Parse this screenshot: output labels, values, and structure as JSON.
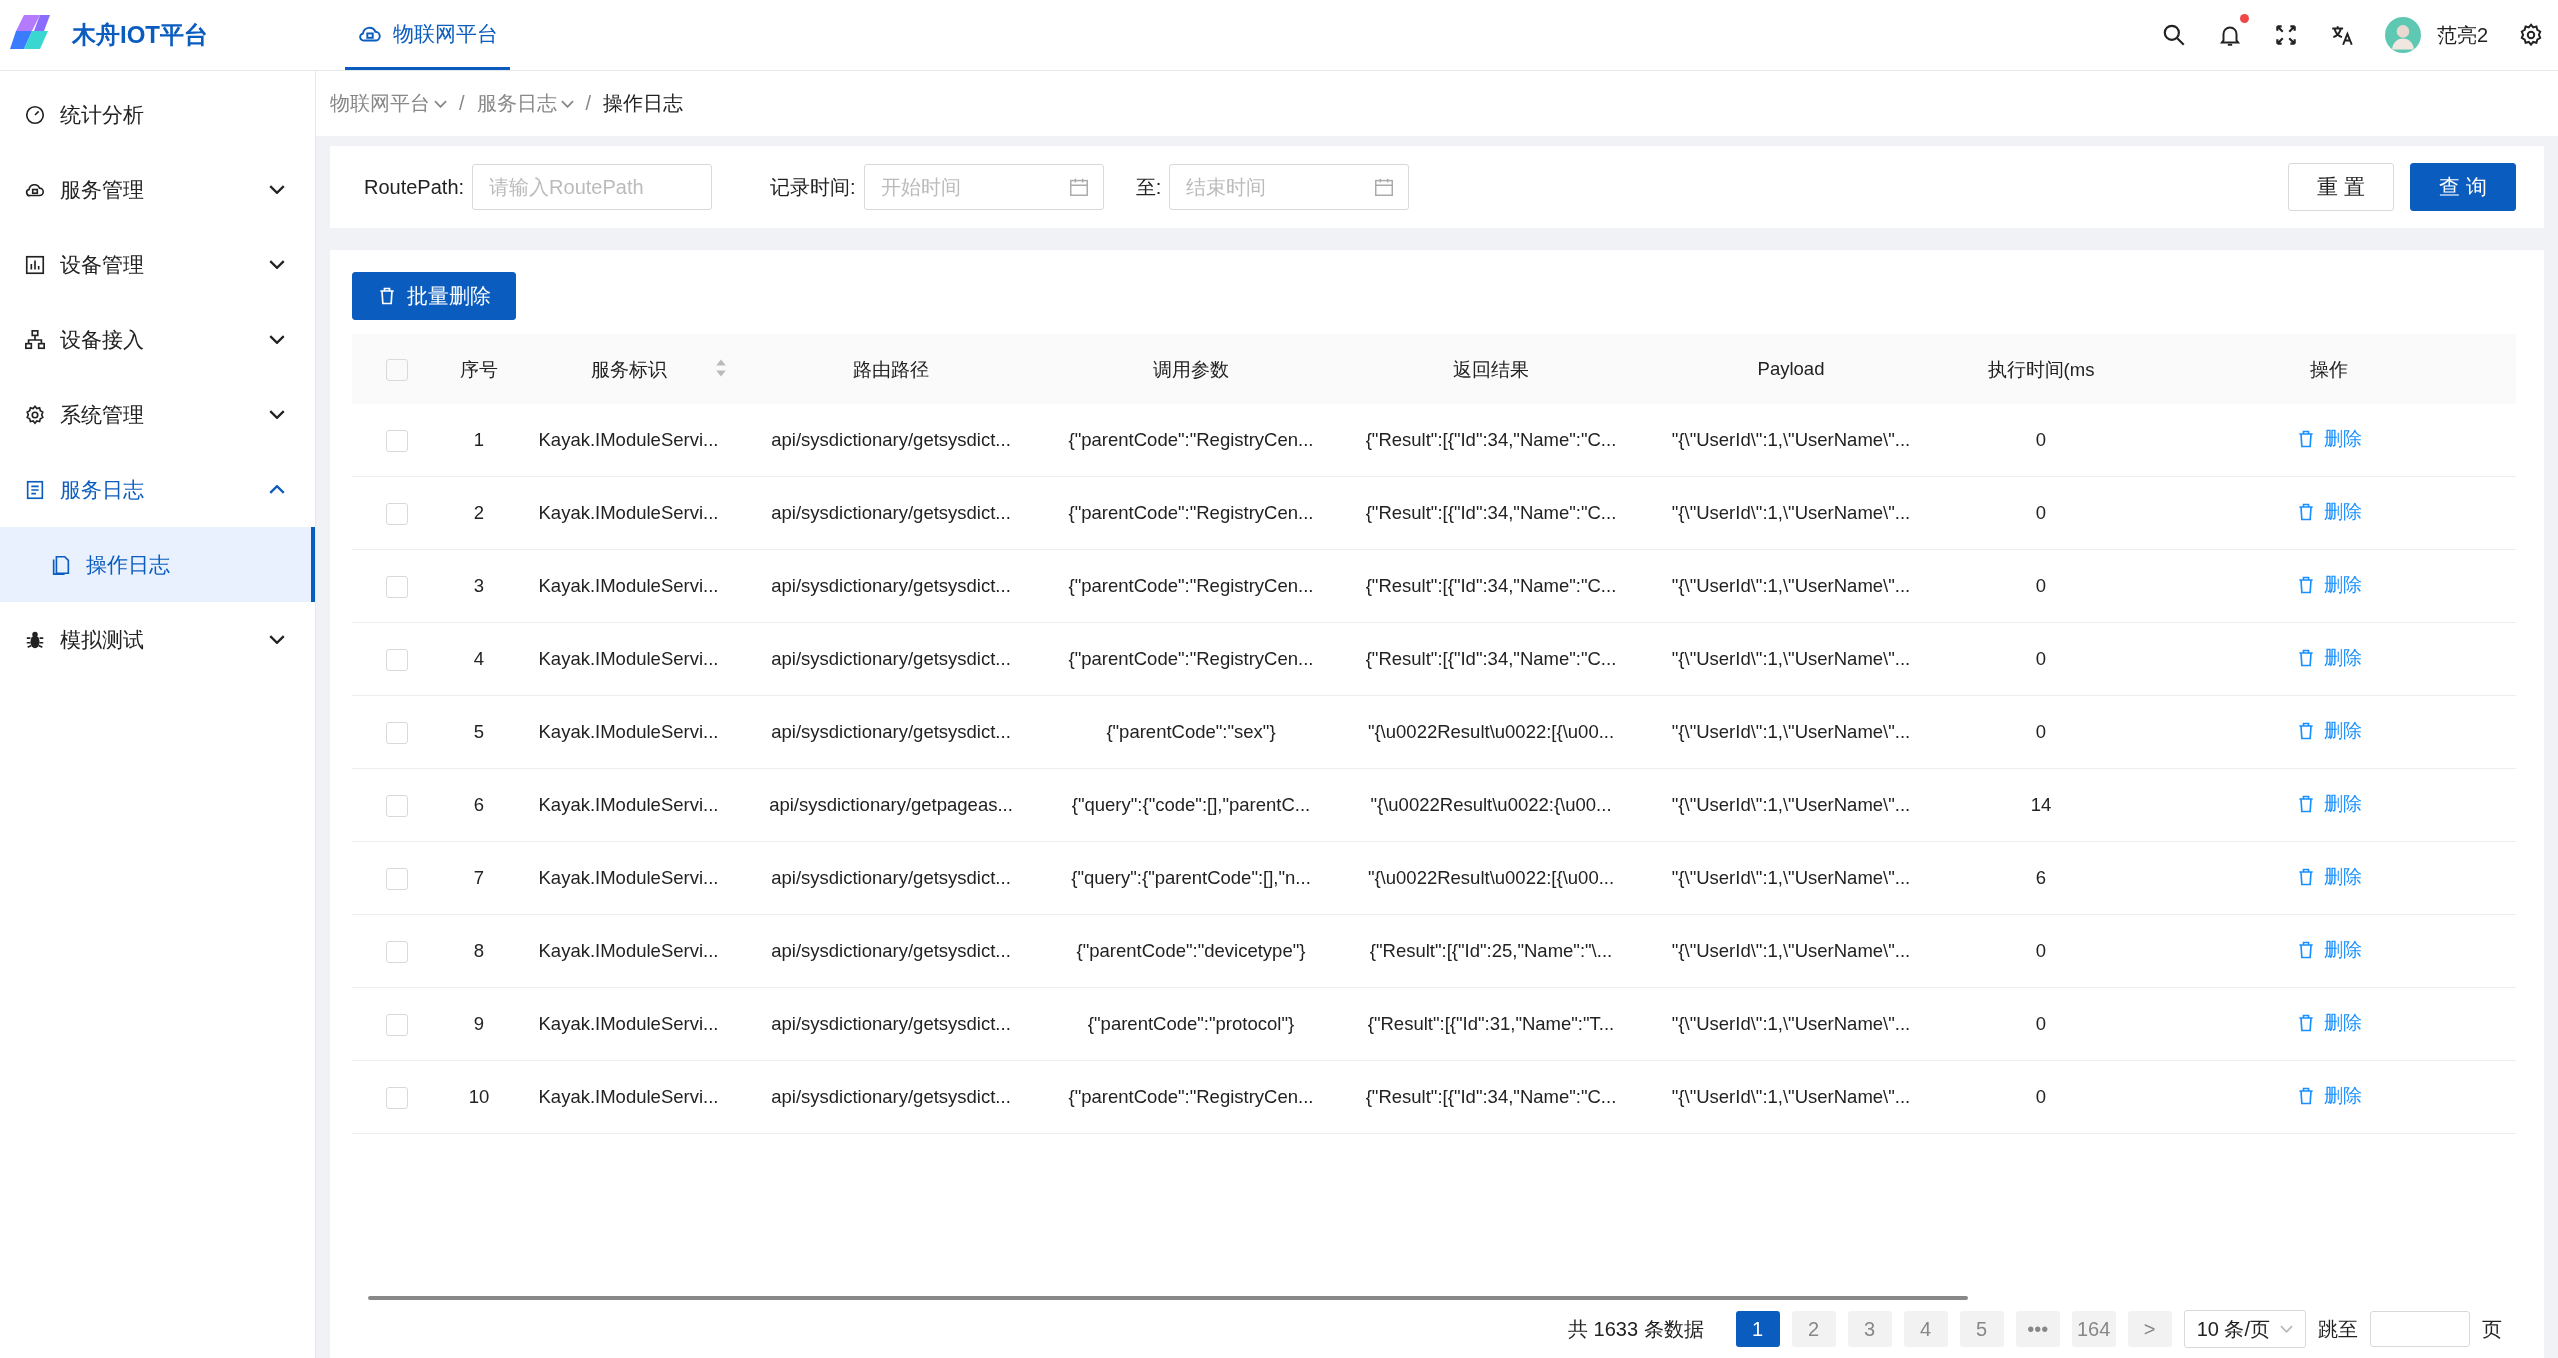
{
  "brand": {
    "title": "木舟IOT平台"
  },
  "top_tabs": [
    {
      "label": "物联网平台",
      "selected": true
    }
  ],
  "header": {
    "notification_dot": true,
    "user_name": "范亮2"
  },
  "sidebar": {
    "items": [
      {
        "label": "统计分析",
        "has_children": false,
        "expanded": false,
        "selected": false
      },
      {
        "label": "服务管理",
        "has_children": true,
        "expanded": false,
        "selected": false
      },
      {
        "label": "设备管理",
        "has_children": true,
        "expanded": false,
        "selected": false
      },
      {
        "label": "设备接入",
        "has_children": true,
        "expanded": false,
        "selected": false
      },
      {
        "label": "系统管理",
        "has_children": true,
        "expanded": false,
        "selected": false
      },
      {
        "label": "服务日志",
        "has_children": true,
        "expanded": true,
        "selected": true,
        "children": [
          {
            "label": "操作日志",
            "selected": true
          }
        ]
      },
      {
        "label": "模拟测试",
        "has_children": true,
        "expanded": false,
        "selected": false
      }
    ]
  },
  "breadcrumb": [
    {
      "label": "物联网平台",
      "dropdown": true
    },
    {
      "separator": "/",
      "label": "服务日志",
      "dropdown": true
    },
    {
      "separator": "/",
      "label": "操作日志",
      "dropdown": false
    }
  ],
  "filters": {
    "route_label": "RoutePath:",
    "route_placeholder": "请输入RoutePath",
    "time_label": "记录时间:",
    "start_placeholder": "开始时间",
    "to_label": "至:",
    "end_placeholder": "结束时间",
    "reset": "重 置",
    "query": "查 询"
  },
  "batch_delete": "批量删除",
  "table": {
    "select_all_checked": false,
    "columns": [
      "序号",
      "服务标识",
      "路由路径",
      "调用参数",
      "返回结果",
      "Payload",
      "执行时间(ms",
      "操作"
    ],
    "rows": [
      {
        "checked": false,
        "cells": [
          "1",
          "Kayak.IModuleServi...",
          "api/sysdictionary/getsysdict...",
          "{\"parentCode\":\"RegistryCen...",
          "{\"Result\":[{\"Id\":34,\"Name\":\"C...",
          "\"{\\\"UserId\\\":1,\\\"UserName\\\"...",
          "0"
        ],
        "action": "删除"
      },
      {
        "checked": false,
        "cells": [
          "2",
          "Kayak.IModuleServi...",
          "api/sysdictionary/getsysdict...",
          "{\"parentCode\":\"RegistryCen...",
          "{\"Result\":[{\"Id\":34,\"Name\":\"C...",
          "\"{\\\"UserId\\\":1,\\\"UserName\\\"...",
          "0"
        ],
        "action": "删除"
      },
      {
        "checked": false,
        "cells": [
          "3",
          "Kayak.IModuleServi...",
          "api/sysdictionary/getsysdict...",
          "{\"parentCode\":\"RegistryCen...",
          "{\"Result\":[{\"Id\":34,\"Name\":\"C...",
          "\"{\\\"UserId\\\":1,\\\"UserName\\\"...",
          "0"
        ],
        "action": "删除"
      },
      {
        "checked": false,
        "cells": [
          "4",
          "Kayak.IModuleServi...",
          "api/sysdictionary/getsysdict...",
          "{\"parentCode\":\"RegistryCen...",
          "{\"Result\":[{\"Id\":34,\"Name\":\"C...",
          "\"{\\\"UserId\\\":1,\\\"UserName\\\"...",
          "0"
        ],
        "action": "删除"
      },
      {
        "checked": false,
        "cells": [
          "5",
          "Kayak.IModuleServi...",
          "api/sysdictionary/getsysdict...",
          "{\"parentCode\":\"sex\"}",
          "\"{\\u0022Result\\u0022:[{\\u00...",
          "\"{\\\"UserId\\\":1,\\\"UserName\\\"...",
          "0"
        ],
        "action": "删除"
      },
      {
        "checked": false,
        "cells": [
          "6",
          "Kayak.IModuleServi...",
          "api/sysdictionary/getpageas...",
          "{\"query\":{\"code\":[],\"parentC...",
          "\"{\\u0022Result\\u0022:{\\u00...",
          "\"{\\\"UserId\\\":1,\\\"UserName\\\"...",
          "14"
        ],
        "action": "删除"
      },
      {
        "checked": false,
        "cells": [
          "7",
          "Kayak.IModuleServi...",
          "api/sysdictionary/getsysdict...",
          "{\"query\":{\"parentCode\":[],\"n...",
          "\"{\\u0022Result\\u0022:[{\\u00...",
          "\"{\\\"UserId\\\":1,\\\"UserName\\\"...",
          "6"
        ],
        "action": "删除"
      },
      {
        "checked": false,
        "cells": [
          "8",
          "Kayak.IModuleServi...",
          "api/sysdictionary/getsysdict...",
          "{\"parentCode\":\"devicetype\"}",
          "{\"Result\":[{\"Id\":25,\"Name\":\"\\...",
          "\"{\\\"UserId\\\":1,\\\"UserName\\\"...",
          "0"
        ],
        "action": "删除"
      },
      {
        "checked": false,
        "cells": [
          "9",
          "Kayak.IModuleServi...",
          "api/sysdictionary/getsysdict...",
          "{\"parentCode\":\"protocol\"}",
          "{\"Result\":[{\"Id\":31,\"Name\":\"T...",
          "\"{\\\"UserId\\\":1,\\\"UserName\\\"...",
          "0"
        ],
        "action": "删除"
      },
      {
        "checked": false,
        "cells": [
          "10",
          "Kayak.IModuleServi...",
          "api/sysdictionary/getsysdict...",
          "{\"parentCode\":\"RegistryCen...",
          "{\"Result\":[{\"Id\":34,\"Name\":\"C...",
          "\"{\\\"UserId\\\":1,\\\"UserName\\\"...",
          "0"
        ],
        "action": "删除"
      }
    ]
  },
  "pagination": {
    "total": "共 1633 条数据",
    "pages": [
      {
        "label": "1",
        "selected": true
      },
      {
        "label": "2",
        "selected": false
      },
      {
        "label": "3",
        "selected": false
      },
      {
        "label": "4",
        "selected": false
      },
      {
        "label": "5",
        "selected": false
      },
      {
        "label": "•••",
        "selected": false
      },
      {
        "label": "164",
        "selected": false
      }
    ],
    "next": ">",
    "page_size": "10 条/页",
    "jump_label": "跳至",
    "page_unit": "页"
  }
}
